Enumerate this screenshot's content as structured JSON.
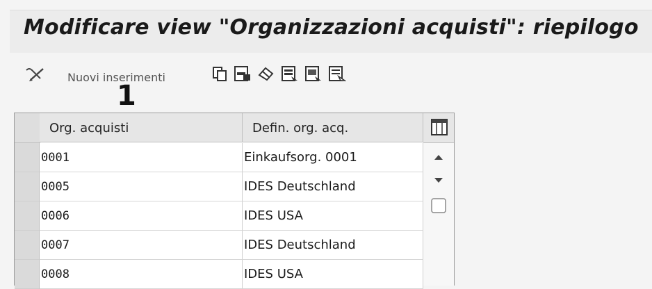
{
  "header": {
    "title": "Modificare view \"Organizzazioni acquisti\": riepilogo"
  },
  "toolbar": {
    "new_entries_label": "Nuovi inserimenti",
    "icons": [
      "edit-icon",
      "copy-icon",
      "save-icon",
      "undo-icon",
      "select-all-icon",
      "select-block-icon",
      "deselect-all-icon"
    ]
  },
  "annotation": {
    "marker": "1"
  },
  "table": {
    "columns": [
      "Org. acquisti",
      "Defin. org. acq."
    ],
    "rows": [
      {
        "code": "0001",
        "name": "Einkaufsorg. 0001"
      },
      {
        "code": "0005",
        "name": "IDES Deutschland"
      },
      {
        "code": "0006",
        "name": "IDES USA"
      },
      {
        "code": "0007",
        "name": "IDES Deutschland"
      },
      {
        "code": "0008",
        "name": "IDES USA"
      }
    ]
  }
}
